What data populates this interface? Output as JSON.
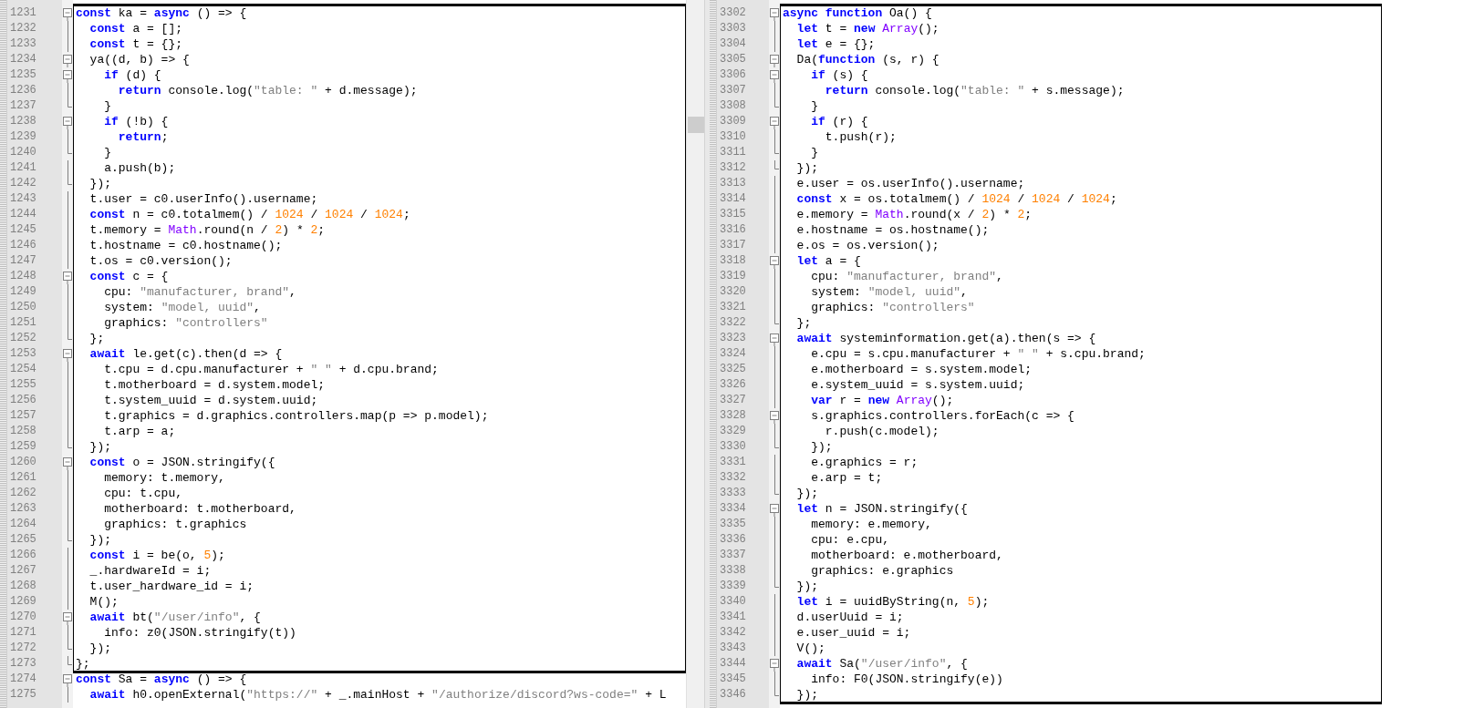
{
  "panes": [
    {
      "scrollbar": true,
      "blocks": [
        {
          "boxed": true,
          "lines": [
            {
              "number": "1231",
              "kind": "fold-start",
              "tokens": [
                {
                  "kind": "kw",
                  "text": "const"
                },
                " ka = ",
                {
                  "kind": "kw",
                  "text": "async"
                },
                " () => {"
              ]
            },
            {
              "number": "1232",
              "kind": "fold-body",
              "tokens": [
                {
                  "kind": "kw",
                  "text": "  const"
                },
                " a = [];"
              ]
            },
            {
              "number": "1233",
              "kind": "fold-body",
              "tokens": [
                {
                  "kind": "kw",
                  "text": "  const"
                },
                " t = {};"
              ]
            },
            {
              "number": "1234",
              "kind": "fold-start",
              "tokens": [
                "  ya((d, b) => {"
              ]
            },
            {
              "number": "1235",
              "kind": "fold-start",
              "tokens": [
                {
                  "kind": "kw",
                  "text": "    if"
                },
                " (d) {"
              ]
            },
            {
              "number": "1236",
              "kind": "fold-body",
              "tokens": [
                {
                  "kind": "kw",
                  "text": "      return"
                },
                " console.log(",
                {
                  "kind": "str",
                  "text": "\"table: \""
                },
                " + d.message);"
              ]
            },
            {
              "number": "1237",
              "kind": "fold-end",
              "tokens": [
                "    }"
              ]
            },
            {
              "number": "1238",
              "kind": "fold-start",
              "tokens": [
                {
                  "kind": "kw",
                  "text": "    if"
                },
                " (!b) {"
              ]
            },
            {
              "number": "1239",
              "kind": "fold-body",
              "tokens": [
                {
                  "kind": "kw",
                  "text": "      return"
                },
                ";"
              ]
            },
            {
              "number": "1240",
              "kind": "fold-end",
              "tokens": [
                "    }"
              ]
            },
            {
              "number": "1241",
              "kind": "fold-body",
              "tokens": [
                "    a.push(b);"
              ]
            },
            {
              "number": "1242",
              "kind": "fold-end",
              "tokens": [
                "  });"
              ]
            },
            {
              "number": "1243",
              "kind": "fold-body",
              "tokens": [
                "  t.user = c0.userInfo().username;"
              ]
            },
            {
              "number": "1244",
              "kind": "fold-body",
              "tokens": [
                {
                  "kind": "kw",
                  "text": "  const"
                },
                " n = c0.totalmem() / ",
                {
                  "kind": "num",
                  "text": "1024"
                },
                " / ",
                {
                  "kind": "num",
                  "text": "1024"
                },
                " / ",
                {
                  "kind": "num",
                  "text": "1024"
                },
                ";"
              ]
            },
            {
              "number": "1245",
              "kind": "fold-body",
              "tokens": [
                "  t.memory = ",
                {
                  "kind": "cls",
                  "text": "Math"
                },
                ".round(n / ",
                {
                  "kind": "num",
                  "text": "2"
                },
                ") * ",
                {
                  "kind": "num",
                  "text": "2"
                },
                ";"
              ]
            },
            {
              "number": "1246",
              "kind": "fold-body",
              "tokens": [
                "  t.hostname = c0.hostname();"
              ]
            },
            {
              "number": "1247",
              "kind": "fold-body",
              "tokens": [
                "  t.os = c0.version();"
              ]
            },
            {
              "number": "1248",
              "kind": "fold-start",
              "tokens": [
                {
                  "kind": "kw",
                  "text": "  const"
                },
                " c = {"
              ]
            },
            {
              "number": "1249",
              "kind": "fold-body",
              "tokens": [
                "    cpu: ",
                {
                  "kind": "str",
                  "text": "\"manufacturer, brand\""
                },
                ","
              ]
            },
            {
              "number": "1250",
              "kind": "fold-body",
              "tokens": [
                "    system: ",
                {
                  "kind": "str",
                  "text": "\"model, uuid\""
                },
                ","
              ]
            },
            {
              "number": "1251",
              "kind": "fold-body",
              "tokens": [
                "    graphics: ",
                {
                  "kind": "str",
                  "text": "\"controllers\""
                }
              ]
            },
            {
              "number": "1252",
              "kind": "fold-end",
              "tokens": [
                "  };"
              ]
            },
            {
              "number": "1253",
              "kind": "fold-start",
              "tokens": [
                {
                  "kind": "kw",
                  "text": "  await"
                },
                " le.get(c).then(d => {"
              ]
            },
            {
              "number": "1254",
              "kind": "fold-body",
              "tokens": [
                "    t.cpu = d.cpu.manufacturer + ",
                {
                  "kind": "str",
                  "text": "\" \""
                },
                " + d.cpu.brand;"
              ]
            },
            {
              "number": "1255",
              "kind": "fold-body",
              "tokens": [
                "    t.motherboard = d.system.model;"
              ]
            },
            {
              "number": "1256",
              "kind": "fold-body",
              "tokens": [
                "    t.system_uuid = d.system.uuid;"
              ]
            },
            {
              "number": "1257",
              "kind": "fold-body",
              "tokens": [
                "    t.graphics = d.graphics.controllers.map(p => p.model);"
              ]
            },
            {
              "number": "1258",
              "kind": "fold-body",
              "tokens": [
                "    t.arp = a;"
              ]
            },
            {
              "number": "1259",
              "kind": "fold-end",
              "tokens": [
                "  });"
              ]
            },
            {
              "number": "1260",
              "kind": "fold-start",
              "tokens": [
                {
                  "kind": "kw",
                  "text": "  const"
                },
                " o = JSON.stringify({"
              ]
            },
            {
              "number": "1261",
              "kind": "fold-body",
              "tokens": [
                "    memory: t.memory,"
              ]
            },
            {
              "number": "1262",
              "kind": "fold-body",
              "tokens": [
                "    cpu: t.cpu,"
              ]
            },
            {
              "number": "1263",
              "kind": "fold-body",
              "tokens": [
                "    motherboard: t.motherboard,"
              ]
            },
            {
              "number": "1264",
              "kind": "fold-body",
              "tokens": [
                "    graphics: t.graphics"
              ]
            },
            {
              "number": "1265",
              "kind": "fold-end",
              "tokens": [
                "  });"
              ]
            },
            {
              "number": "1266",
              "kind": "fold-body",
              "tokens": [
                {
                  "kind": "kw",
                  "text": "  const"
                },
                " i = be(o, ",
                {
                  "kind": "num",
                  "text": "5"
                },
                ");"
              ]
            },
            {
              "number": "1267",
              "kind": "fold-body",
              "tokens": [
                "  _.hardwareId = i;"
              ]
            },
            {
              "number": "1268",
              "kind": "fold-body",
              "tokens": [
                "  t.user_hardware_id = i;"
              ]
            },
            {
              "number": "1269",
              "kind": "fold-body",
              "tokens": [
                "  M();"
              ]
            },
            {
              "number": "1270",
              "kind": "fold-start",
              "tokens": [
                {
                  "kind": "kw",
                  "text": "  await"
                },
                " bt(",
                {
                  "kind": "str",
                  "text": "\"/user/info\""
                },
                ", {"
              ]
            },
            {
              "number": "1271",
              "kind": "fold-body",
              "tokens": [
                "    info: z0(JSON.stringify(t))"
              ]
            },
            {
              "number": "1272",
              "kind": "fold-end",
              "tokens": [
                "  });"
              ]
            },
            {
              "number": "1273",
              "kind": "fold-end",
              "tokens": [
                "};"
              ]
            }
          ]
        },
        {
          "boxed": false,
          "lines": [
            {
              "number": "1274",
              "kind": "fold-start",
              "tokens": [
                {
                  "kind": "kw",
                  "text": "const"
                },
                " Sa = ",
                {
                  "kind": "kw",
                  "text": "async"
                },
                " () => {"
              ]
            },
            {
              "number": "1275",
              "kind": "fold-body",
              "tokens": [
                {
                  "kind": "kw",
                  "text": "  await"
                },
                " h0.openExternal(",
                {
                  "kind": "str",
                  "text": "\"https://\""
                },
                " + _.mainHost + ",
                {
                  "kind": "str",
                  "text": "\"/authorize/discord?ws-code=\""
                },
                " + L"
              ]
            }
          ]
        }
      ]
    },
    {
      "scrollbar": false,
      "blocks": [
        {
          "boxed": true,
          "lines": [
            {
              "number": "3302",
              "kind": "fold-start",
              "tokens": [
                {
                  "kind": "kw",
                  "text": "async function"
                },
                " Oa() {"
              ]
            },
            {
              "number": "3303",
              "kind": "fold-body",
              "tokens": [
                {
                  "kind": "kw",
                  "text": "  let"
                },
                " t = ",
                {
                  "kind": "kw",
                  "text": "new "
                },
                {
                  "kind": "cls",
                  "text": "Array"
                },
                "();"
              ]
            },
            {
              "number": "3304",
              "kind": "fold-body",
              "tokens": [
                {
                  "kind": "kw",
                  "text": "  let"
                },
                " e = {};"
              ]
            },
            {
              "number": "3305",
              "kind": "fold-start",
              "tokens": [
                "  Da(",
                {
                  "kind": "kw",
                  "text": "function"
                },
                " (s, r) {"
              ]
            },
            {
              "number": "3306",
              "kind": "fold-start",
              "tokens": [
                {
                  "kind": "kw",
                  "text": "    if"
                },
                " (s) {"
              ]
            },
            {
              "number": "3307",
              "kind": "fold-body",
              "tokens": [
                {
                  "kind": "kw",
                  "text": "      return"
                },
                " console.log(",
                {
                  "kind": "str",
                  "text": "\"table: \""
                },
                " + s.message);"
              ]
            },
            {
              "number": "3308",
              "kind": "fold-end",
              "tokens": [
                "    }"
              ]
            },
            {
              "number": "3309",
              "kind": "fold-start",
              "tokens": [
                {
                  "kind": "kw",
                  "text": "    if"
                },
                " (r) {"
              ]
            },
            {
              "number": "3310",
              "kind": "fold-body",
              "tokens": [
                "      t.push(r);"
              ]
            },
            {
              "number": "3311",
              "kind": "fold-end",
              "tokens": [
                "    }"
              ]
            },
            {
              "number": "3312",
              "kind": "fold-end",
              "tokens": [
                "  });"
              ]
            },
            {
              "number": "3313",
              "kind": "fold-body",
              "tokens": [
                "  e.user = os.userInfo().username;"
              ]
            },
            {
              "number": "3314",
              "kind": "fold-body",
              "tokens": [
                {
                  "kind": "kw",
                  "text": "  const"
                },
                " x = os.totalmem() / ",
                {
                  "kind": "num",
                  "text": "1024"
                },
                " / ",
                {
                  "kind": "num",
                  "text": "1024"
                },
                " / ",
                {
                  "kind": "num",
                  "text": "1024"
                },
                ";"
              ]
            },
            {
              "number": "3315",
              "kind": "fold-body",
              "tokens": [
                "  e.memory = ",
                {
                  "kind": "cls",
                  "text": "Math"
                },
                ".round(x / ",
                {
                  "kind": "num",
                  "text": "2"
                },
                ") * ",
                {
                  "kind": "num",
                  "text": "2"
                },
                ";"
              ]
            },
            {
              "number": "3316",
              "kind": "fold-body",
              "tokens": [
                "  e.hostname = os.hostname();"
              ]
            },
            {
              "number": "3317",
              "kind": "fold-body",
              "tokens": [
                "  e.os = os.version();"
              ]
            },
            {
              "number": "3318",
              "kind": "fold-start",
              "tokens": [
                {
                  "kind": "kw",
                  "text": "  let"
                },
                " a = {"
              ]
            },
            {
              "number": "3319",
              "kind": "fold-body",
              "tokens": [
                "    cpu: ",
                {
                  "kind": "str",
                  "text": "\"manufacturer, brand\""
                },
                ","
              ]
            },
            {
              "number": "3320",
              "kind": "fold-body",
              "tokens": [
                "    system: ",
                {
                  "kind": "str",
                  "text": "\"model, uuid\""
                },
                ","
              ]
            },
            {
              "number": "3321",
              "kind": "fold-body",
              "tokens": [
                "    graphics: ",
                {
                  "kind": "str",
                  "text": "\"controllers\""
                }
              ]
            },
            {
              "number": "3322",
              "kind": "fold-end",
              "tokens": [
                "  };"
              ]
            },
            {
              "number": "3323",
              "kind": "fold-start",
              "tokens": [
                {
                  "kind": "kw",
                  "text": "  await"
                },
                " systeminformation.get(a).then(s => {"
              ]
            },
            {
              "number": "3324",
              "kind": "fold-body",
              "tokens": [
                "    e.cpu = s.cpu.manufacturer + ",
                {
                  "kind": "str",
                  "text": "\" \""
                },
                " + s.cpu.brand;"
              ]
            },
            {
              "number": "3325",
              "kind": "fold-body",
              "tokens": [
                "    e.motherboard = s.system.model;"
              ]
            },
            {
              "number": "3326",
              "kind": "fold-body",
              "tokens": [
                "    e.system_uuid = s.system.uuid;"
              ]
            },
            {
              "number": "3327",
              "kind": "fold-body",
              "tokens": [
                {
                  "kind": "kw",
                  "text": "    var"
                },
                " r = ",
                {
                  "kind": "kw",
                  "text": "new "
                },
                {
                  "kind": "cls",
                  "text": "Array"
                },
                "();"
              ]
            },
            {
              "number": "3328",
              "kind": "fold-start",
              "tokens": [
                "    s.graphics.controllers.forEach(c => {"
              ]
            },
            {
              "number": "3329",
              "kind": "fold-body",
              "tokens": [
                "      r.push(c.model);"
              ]
            },
            {
              "number": "3330",
              "kind": "fold-end",
              "tokens": [
                "    });"
              ]
            },
            {
              "number": "3331",
              "kind": "fold-body",
              "tokens": [
                "    e.graphics = r;"
              ]
            },
            {
              "number": "3332",
              "kind": "fold-body",
              "tokens": [
                "    e.arp = t;"
              ]
            },
            {
              "number": "3333",
              "kind": "fold-end",
              "tokens": [
                "  });"
              ]
            },
            {
              "number": "3334",
              "kind": "fold-start",
              "tokens": [
                {
                  "kind": "kw",
                  "text": "  let"
                },
                " n = JSON.stringify({"
              ]
            },
            {
              "number": "3335",
              "kind": "fold-body",
              "tokens": [
                "    memory: e.memory,"
              ]
            },
            {
              "number": "3336",
              "kind": "fold-body",
              "tokens": [
                "    cpu: e.cpu,"
              ]
            },
            {
              "number": "3337",
              "kind": "fold-body",
              "tokens": [
                "    motherboard: e.motherboard,"
              ]
            },
            {
              "number": "3338",
              "kind": "fold-body",
              "tokens": [
                "    graphics: e.graphics"
              ]
            },
            {
              "number": "3339",
              "kind": "fold-end",
              "tokens": [
                "  });"
              ]
            },
            {
              "number": "3340",
              "kind": "fold-body",
              "tokens": [
                {
                  "kind": "kw",
                  "text": "  let"
                },
                " i = uuidByString(n, ",
                {
                  "kind": "num",
                  "text": "5"
                },
                ");"
              ]
            },
            {
              "number": "3341",
              "kind": "fold-body",
              "tokens": [
                "  d.userUuid = i;"
              ]
            },
            {
              "number": "3342",
              "kind": "fold-body",
              "tokens": [
                "  e.user_uuid = i;"
              ]
            },
            {
              "number": "3343",
              "kind": "fold-body",
              "tokens": [
                "  V();"
              ]
            },
            {
              "number": "3344",
              "kind": "fold-start",
              "tokens": [
                {
                  "kind": "kw",
                  "text": "  await"
                },
                " Sa(",
                {
                  "kind": "str",
                  "text": "\"/user/info\""
                },
                ", {"
              ]
            },
            {
              "number": "3345",
              "kind": "fold-body",
              "tokens": [
                "    info: F0(JSON.stringify(e))"
              ]
            },
            {
              "number": "3346",
              "kind": "fold-end",
              "tokens": [
                "  });"
              ]
            }
          ]
        }
      ]
    }
  ]
}
